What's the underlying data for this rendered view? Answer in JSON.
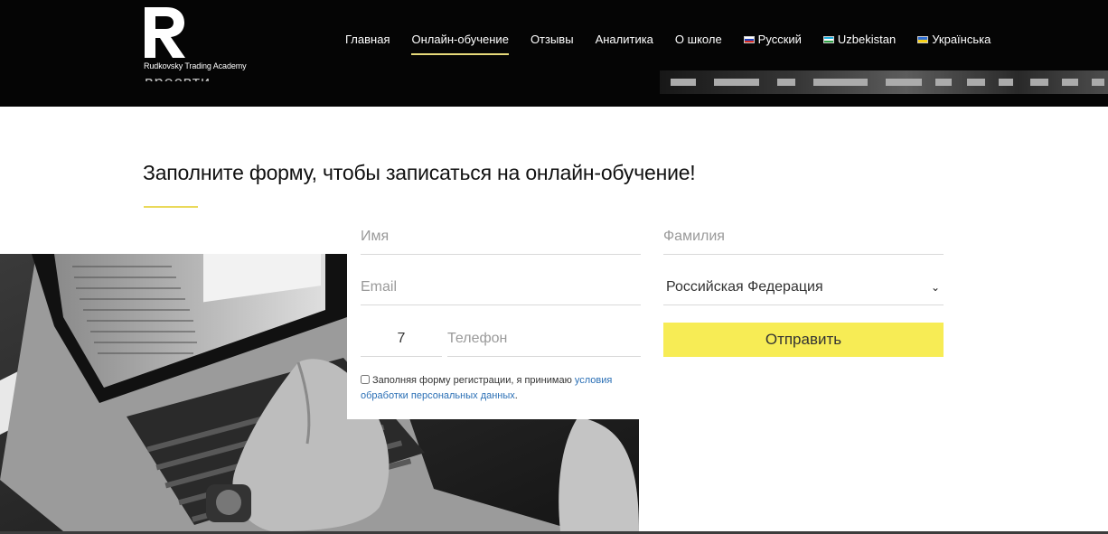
{
  "header": {
    "logo_letter": "R",
    "brand_name": "Rudkovsky Trading Academy",
    "hero_text_fragment": "вресвти",
    "nav": [
      {
        "label": "Главная",
        "active": false
      },
      {
        "label": "Онлайн-обучение",
        "active": true
      },
      {
        "label": "Отзывы",
        "active": false
      },
      {
        "label": "Аналитика",
        "active": false
      },
      {
        "label": "О школе",
        "active": false
      },
      {
        "label": "Русский",
        "flag": "ru"
      },
      {
        "label": "Uzbekistan",
        "flag": "uz"
      },
      {
        "label": "Українська",
        "flag": "ua"
      }
    ]
  },
  "section": {
    "title": "Заполните форму, чтобы записаться на онлайн-обучение!",
    "accent_color": "#ead95b"
  },
  "form": {
    "name_placeholder": "Имя",
    "surname_placeholder": "Фамилия",
    "email_placeholder": "Email",
    "country_value": "Российская Федерация",
    "phone_code": "7",
    "phone_placeholder": "Телефон",
    "submit_label": "Отправить",
    "submit_color": "#f7ec55",
    "consent_text": "Заполняя форму регистрации, я принимаю ",
    "consent_link": "условия обработки персональных данных",
    "consent_end": ".",
    "link_color": "#2a6fb5"
  }
}
